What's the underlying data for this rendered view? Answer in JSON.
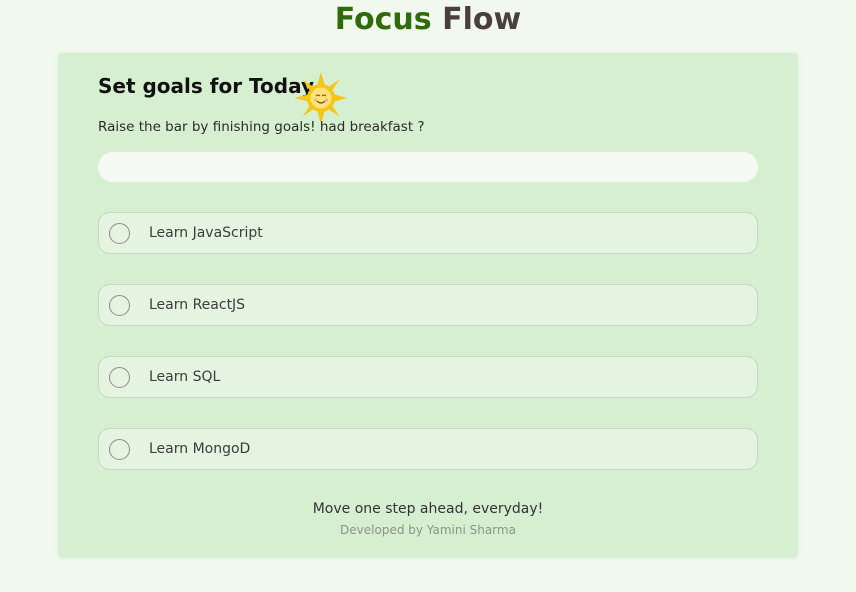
{
  "app": {
    "title_part1": "Focus",
    "title_part2": "Flow",
    "colors": {
      "focus": "#2f6b0a",
      "flow": "#4a3f3d",
      "card": "#d6efd1",
      "background": "#f1f8ee"
    }
  },
  "card": {
    "heading": "Set goals for Today",
    "heading_icon": "sun-icon",
    "subtitle": "Raise the bar by finishing goals! had breakfast ?",
    "input": {
      "value": "",
      "placeholder": ""
    },
    "goals": [
      {
        "label": "Learn JavaScript",
        "completed": false
      },
      {
        "label": "Learn ReactJS",
        "completed": false
      },
      {
        "label": "Learn SQL",
        "completed": false
      },
      {
        "label": "Learn MongoD",
        "completed": false
      }
    ],
    "footer_quote": "Move one step ahead, everyday!",
    "footer_credit": "Developed by Yamini Sharma"
  }
}
